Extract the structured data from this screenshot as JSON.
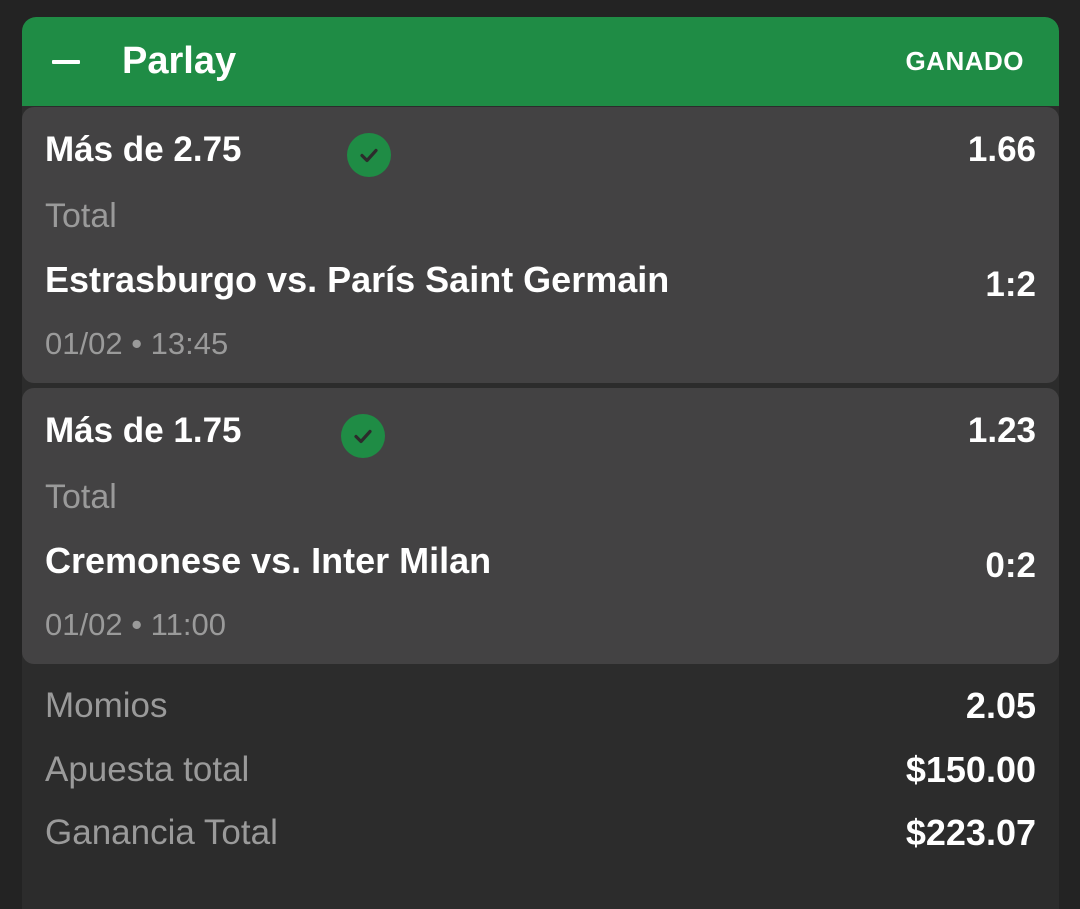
{
  "header": {
    "title": "Parlay",
    "status": "GANADO",
    "collapse_icon": "minus-icon",
    "color": "#1f8c45"
  },
  "legs": [
    {
      "market": "Más de 2.75",
      "result_icon": "check-circle-icon",
      "odds": "1.66",
      "type": "Total",
      "match": "Estrasburgo vs. París Saint Germain",
      "score": "1:2",
      "datetime": "01/02 • 13:45"
    },
    {
      "market": "Más de 1.75",
      "result_icon": "check-circle-icon",
      "odds": "1.23",
      "type": "Total",
      "match": "Cremonese vs. Inter Milan",
      "score": "0:2",
      "datetime": "01/02 • 11:00"
    }
  ],
  "summary": {
    "odds_label": "Momios",
    "odds_value": "2.05",
    "stake_label": "Apuesta total",
    "stake_value": "$150.00",
    "win_label": "Ganancia Total",
    "win_value": "$223.07"
  }
}
